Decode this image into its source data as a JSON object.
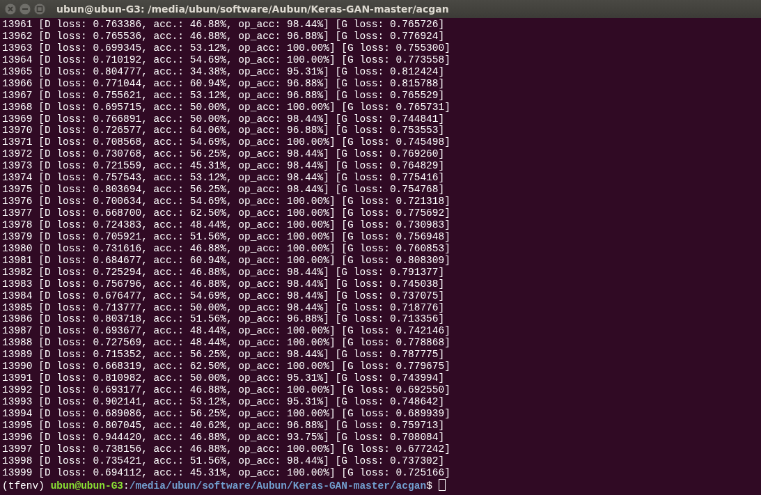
{
  "window": {
    "title": "ubun@ubun-G3: /media/ubun/software/Aubun/Keras-GAN-master/acgan"
  },
  "lines": [
    "13961 [D loss: 0.763386, acc.: 46.88%, op_acc: 98.44%] [G loss: 0.765726]",
    "13962 [D loss: 0.765536, acc.: 46.88%, op_acc: 96.88%] [G loss: 0.776924]",
    "13963 [D loss: 0.699345, acc.: 53.12%, op_acc: 100.00%] [G loss: 0.755300]",
    "13964 [D loss: 0.710192, acc.: 54.69%, op_acc: 100.00%] [G loss: 0.773558]",
    "13965 [D loss: 0.804777, acc.: 34.38%, op_acc: 95.31%] [G loss: 0.812424]",
    "13966 [D loss: 0.771044, acc.: 60.94%, op_acc: 96.88%] [G loss: 0.815788]",
    "13967 [D loss: 0.755621, acc.: 53.12%, op_acc: 96.88%] [G loss: 0.765529]",
    "13968 [D loss: 0.695715, acc.: 50.00%, op_acc: 100.00%] [G loss: 0.765731]",
    "13969 [D loss: 0.766891, acc.: 50.00%, op_acc: 98.44%] [G loss: 0.744841]",
    "13970 [D loss: 0.726577, acc.: 64.06%, op_acc: 96.88%] [G loss: 0.753553]",
    "13971 [D loss: 0.708568, acc.: 54.69%, op_acc: 100.00%] [G loss: 0.745498]",
    "13972 [D loss: 0.730768, acc.: 56.25%, op_acc: 98.44%] [G loss: 0.769260]",
    "13973 [D loss: 0.721559, acc.: 45.31%, op_acc: 98.44%] [G loss: 0.764829]",
    "13974 [D loss: 0.757543, acc.: 53.12%, op_acc: 98.44%] [G loss: 0.775416]",
    "13975 [D loss: 0.803694, acc.: 56.25%, op_acc: 98.44%] [G loss: 0.754768]",
    "13976 [D loss: 0.700634, acc.: 54.69%, op_acc: 100.00%] [G loss: 0.721318]",
    "13977 [D loss: 0.668700, acc.: 62.50%, op_acc: 100.00%] [G loss: 0.775692]",
    "13978 [D loss: 0.724383, acc.: 48.44%, op_acc: 100.00%] [G loss: 0.730983]",
    "13979 [D loss: 0.705921, acc.: 51.56%, op_acc: 100.00%] [G loss: 0.756948]",
    "13980 [D loss: 0.731616, acc.: 46.88%, op_acc: 100.00%] [G loss: 0.760853]",
    "13981 [D loss: 0.684677, acc.: 60.94%, op_acc: 100.00%] [G loss: 0.808309]",
    "13982 [D loss: 0.725294, acc.: 46.88%, op_acc: 98.44%] [G loss: 0.791377]",
    "13983 [D loss: 0.756796, acc.: 46.88%, op_acc: 98.44%] [G loss: 0.745038]",
    "13984 [D loss: 0.676477, acc.: 54.69%, op_acc: 98.44%] [G loss: 0.737075]",
    "13985 [D loss: 0.713777, acc.: 50.00%, op_acc: 98.44%] [G loss: 0.718776]",
    "13986 [D loss: 0.803718, acc.: 51.56%, op_acc: 96.88%] [G loss: 0.713356]",
    "13987 [D loss: 0.693677, acc.: 48.44%, op_acc: 100.00%] [G loss: 0.742146]",
    "13988 [D loss: 0.727569, acc.: 48.44%, op_acc: 100.00%] [G loss: 0.778868]",
    "13989 [D loss: 0.715352, acc.: 56.25%, op_acc: 98.44%] [G loss: 0.787775]",
    "13990 [D loss: 0.668319, acc.: 62.50%, op_acc: 100.00%] [G loss: 0.779675]",
    "13991 [D loss: 0.810982, acc.: 50.00%, op_acc: 95.31%] [G loss: 0.743994]",
    "13992 [D loss: 0.693177, acc.: 46.88%, op_acc: 100.00%] [G loss: 0.692550]",
    "13993 [D loss: 0.902141, acc.: 53.12%, op_acc: 95.31%] [G loss: 0.748642]",
    "13994 [D loss: 0.689086, acc.: 56.25%, op_acc: 100.00%] [G loss: 0.689939]",
    "13995 [D loss: 0.807045, acc.: 40.62%, op_acc: 96.88%] [G loss: 0.759713]",
    "13996 [D loss: 0.944420, acc.: 46.88%, op_acc: 93.75%] [G loss: 0.708084]",
    "13997 [D loss: 0.738156, acc.: 46.88%, op_acc: 100.00%] [G loss: 0.677242]",
    "13998 [D loss: 0.735421, acc.: 51.56%, op_acc: 98.44%] [G loss: 0.737302]",
    "13999 [D loss: 0.694112, acc.: 45.31%, op_acc: 100.00%] [G loss: 0.725166]"
  ],
  "prompt": {
    "env": "(tfenv)",
    "user_host": "ubun@ubun-G3",
    "separator": ":",
    "path": "/media/ubun/software/Aubun/Keras-GAN-master/acgan",
    "symbol": "$"
  }
}
